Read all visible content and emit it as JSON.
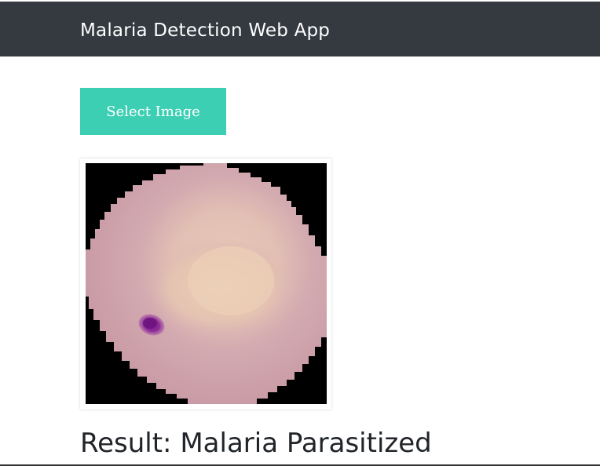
{
  "navbar": {
    "brand": "Malaria Detection Web App",
    "background": "#343a40"
  },
  "upload": {
    "button_label": "Select Image",
    "button_color": "#3dcfb4"
  },
  "preview": {
    "alt": "Uploaded blood cell image"
  },
  "result": {
    "label": "Result:",
    "value": "Malaria Parasitized"
  }
}
